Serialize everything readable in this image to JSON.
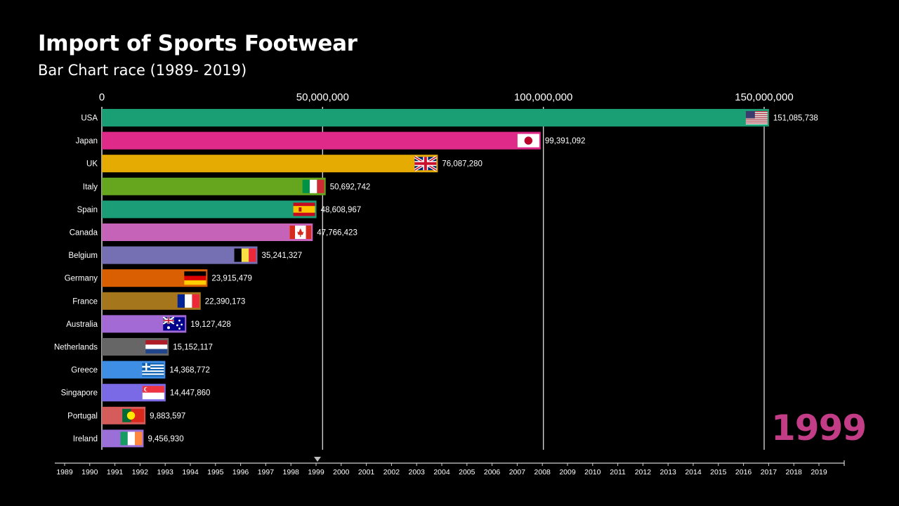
{
  "header": {
    "title": "Import of Sports Footwear",
    "subtitle": "Bar Chart race (1989- 2019)"
  },
  "current_year": "1999",
  "colors": {
    "background": "#000000",
    "text": "#ffffff",
    "year_label": "#c23d86",
    "grid": "#d0d0d0"
  },
  "chart_data": {
    "type": "bar",
    "orientation": "horizontal",
    "title": "Import of Sports Footwear",
    "subtitle": "Bar Chart race (1989- 2019)",
    "xlim": [
      0,
      150000000
    ],
    "x_ticks": [
      0,
      50000000,
      100000000,
      150000000
    ],
    "x_tick_labels": [
      "0",
      "50,000,000",
      "100,000,000",
      "150,000,000"
    ],
    "grid": true,
    "categories": [
      "USA",
      "Japan",
      "UK",
      "Italy",
      "Spain",
      "Canada",
      "Belgium",
      "Germany",
      "France",
      "Australia",
      "Netherlands",
      "Greece",
      "Singapore",
      "Portugal",
      "Ireland"
    ],
    "values": [
      151085738,
      99391092,
      76087280,
      50692742,
      48608967,
      47766423,
      35241327,
      23915479,
      22390173,
      19127428,
      15152117,
      14368772,
      14447860,
      9883597,
      9456930
    ],
    "value_labels": [
      "151,085,738",
      "99,391,092",
      "76,087,280",
      "50,692,742",
      "48,608,967",
      "47,766,423",
      "35,241,327",
      "23,915,479",
      "22,390,173",
      "19,127,428",
      "15,152,117",
      "14,368,772",
      "14,447,860",
      "9,883,597",
      "9,456,930"
    ],
    "bar_colors": [
      "#1a9e74",
      "#e02a8a",
      "#e6ab02",
      "#66a61e",
      "#1b9e77",
      "#c463b8",
      "#7570b3",
      "#d95f02",
      "#a6761d",
      "#a36ad6",
      "#666666",
      "#3f8ee6",
      "#7b6ae6",
      "#d65c5c",
      "#9b6fd8"
    ],
    "flags": [
      "us-flag-icon",
      "japan-flag-icon",
      "uk-flag-icon",
      "italy-flag-icon",
      "spain-flag-icon",
      "canada-flag-icon",
      "belgium-flag-icon",
      "germany-flag-icon",
      "france-flag-icon",
      "australia-flag-icon",
      "netherlands-flag-icon",
      "greece-flag-icon",
      "singapore-flag-icon",
      "portugal-flag-icon",
      "ireland-flag-icon"
    ]
  },
  "timeline": {
    "years": [
      "1989",
      "1990",
      "1991",
      "1992",
      "1993",
      "1994",
      "1995",
      "1996",
      "1997",
      "1998",
      "1999",
      "2000",
      "2001",
      "2002",
      "2003",
      "2004",
      "2005",
      "2006",
      "2007",
      "2008",
      "2009",
      "2010",
      "2011",
      "2012",
      "2013",
      "2014",
      "2015",
      "2016",
      "2017",
      "2018",
      "2019"
    ],
    "current": "1999"
  }
}
